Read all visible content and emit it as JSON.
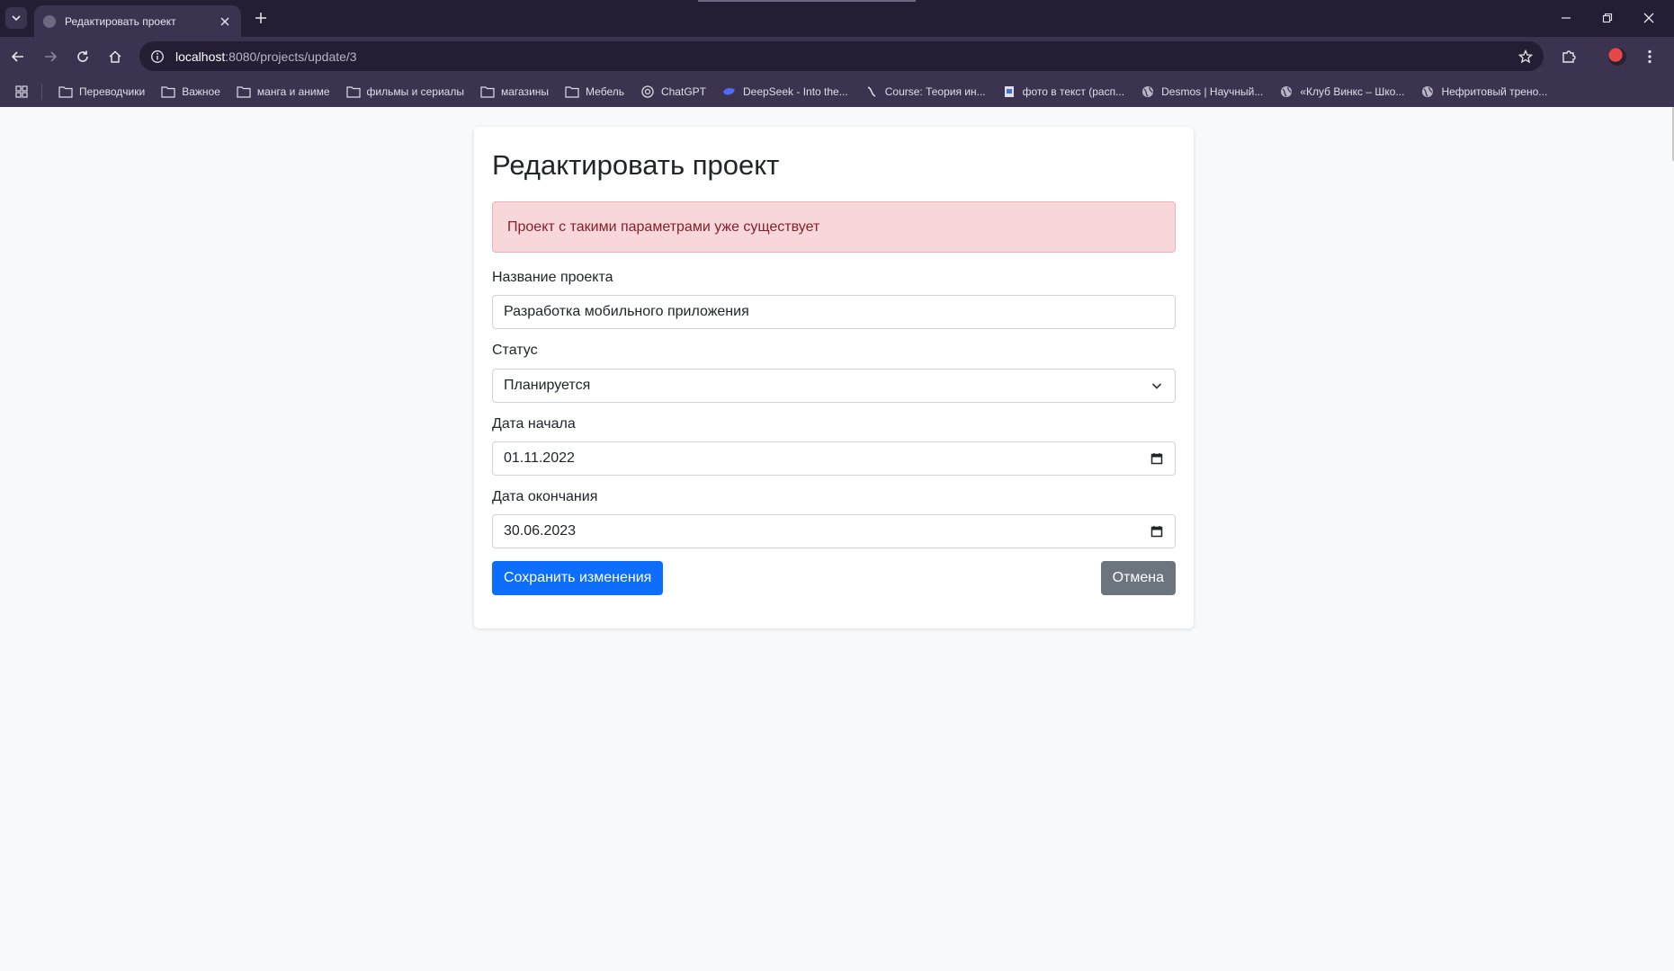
{
  "browser": {
    "tab": {
      "title": "Редактировать проект"
    },
    "address": {
      "host": "localhost",
      "path": ":8080/projects/update/3"
    },
    "bookmarks": [
      {
        "label": "Переводчики",
        "icon": "folder-icon"
      },
      {
        "label": "Важное",
        "icon": "folder-icon"
      },
      {
        "label": "манга и аниме",
        "icon": "folder-icon"
      },
      {
        "label": "фильмы и сериалы",
        "icon": "folder-icon"
      },
      {
        "label": "магазины",
        "icon": "folder-icon"
      },
      {
        "label": "Мебель",
        "icon": "folder-icon"
      },
      {
        "label": "ChatGPT",
        "icon": "chatgpt-icon"
      },
      {
        "label": "DeepSeek - Into the...",
        "icon": "deepseek-icon"
      },
      {
        "label": "Course: Теория ин...",
        "icon": "course-icon"
      },
      {
        "label": "фото в текст (расп...",
        "icon": "site-icon"
      },
      {
        "label": "Desmos | Научный...",
        "icon": "globe-icon"
      },
      {
        "label": "«Клуб Винкс – Шко...",
        "icon": "globe-icon"
      },
      {
        "label": "Нефритовый трено...",
        "icon": "globe-icon"
      }
    ]
  },
  "page": {
    "title": "Редактировать проект",
    "alert": "Проект с такими параметрами уже существует",
    "fields": {
      "name": {
        "label": "Название проекта",
        "value": "Разработка мобильного приложения"
      },
      "status": {
        "label": "Статус",
        "value": "Планируется"
      },
      "start_date": {
        "label": "Дата начала",
        "value": "01.11.2022"
      },
      "end_date": {
        "label": "Дата окончания",
        "value": "30.06.2023"
      }
    },
    "buttons": {
      "save": "Сохранить изменения",
      "cancel": "Отмена"
    }
  },
  "colors": {
    "primary": "#0d6efd",
    "secondary": "#6c757d",
    "alert_bg": "#f8d7da",
    "alert_text": "#842029",
    "browser_frame": "#241d34",
    "browser_toolbar": "#3b3350"
  }
}
